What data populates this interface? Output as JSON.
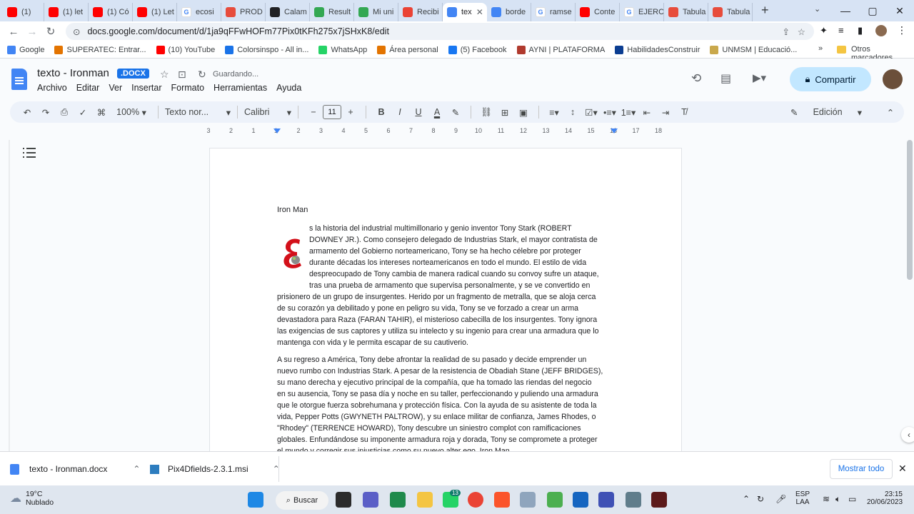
{
  "tabs": [
    {
      "label": "(1)",
      "icon": "youtube-icon"
    },
    {
      "label": "(1) let",
      "icon": "youtube-icon"
    },
    {
      "label": "(1) Có",
      "icon": "youtube-icon"
    },
    {
      "label": "(1) Let",
      "icon": "youtube-icon"
    },
    {
      "label": "ecosi",
      "icon": "google-icon"
    },
    {
      "label": "PROD",
      "icon": "tabulator-icon"
    },
    {
      "label": "Calam",
      "icon": "calameo-icon"
    },
    {
      "label": "Result",
      "icon": "drive-icon"
    },
    {
      "label": "Mi uni",
      "icon": "drive-icon"
    },
    {
      "label": "Recibi",
      "icon": "gmail-icon"
    },
    {
      "label": "tex",
      "icon": "docs-icon",
      "active": true
    },
    {
      "label": "borde",
      "icon": "docs-icon"
    },
    {
      "label": "ramse",
      "icon": "google-icon"
    },
    {
      "label": "Conte",
      "icon": "youtube-icon"
    },
    {
      "label": "EJERC",
      "icon": "google-icon"
    },
    {
      "label": "Tabula",
      "icon": "tabulator-icon"
    },
    {
      "label": "Tabula",
      "icon": "tabulator-icon"
    }
  ],
  "address": {
    "url": "docs.google.com/document/d/1ja9qFFwHOFm77Pix0tKFh275x7jSHxK8/edit"
  },
  "bookmarks": [
    {
      "label": "Google",
      "color": "#4285f4"
    },
    {
      "label": "SUPERATEC: Entrar...",
      "color": "#e37400"
    },
    {
      "label": "(10) YouTube",
      "color": "#ff0000"
    },
    {
      "label": "Colorsinspo - All in...",
      "color": "#1a73e8"
    },
    {
      "label": "WhatsApp",
      "color": "#25d366"
    },
    {
      "label": "Área personal",
      "color": "#e37400"
    },
    {
      "label": "(5) Facebook",
      "color": "#1877f2"
    },
    {
      "label": "AYNI | PLATAFORMA",
      "color": "#b03a2e"
    },
    {
      "label": "HabilidadesConstruir",
      "color": "#0b3d91"
    },
    {
      "label": "UNMSM | Educació...",
      "color": "#c9a84c"
    }
  ],
  "bookmarks_more": "Otros marcadores",
  "doc": {
    "title": "texto - Ironman",
    "badge": ".DOCX",
    "saving": "Guardando...",
    "menu": [
      "Archivo",
      "Editar",
      "Ver",
      "Insertar",
      "Formato",
      "Herramientas",
      "Ayuda"
    ],
    "share": "Compartir"
  },
  "toolbar": {
    "zoom": "100%",
    "style": "Texto nor...",
    "font": "Calibri",
    "size": "11",
    "mode": "Edición"
  },
  "ruler_labels": [
    "3",
    "2",
    "1",
    "1",
    "2",
    "3",
    "4",
    "5",
    "6",
    "7",
    "8",
    "9",
    "10",
    "11",
    "12",
    "13",
    "14",
    "15",
    "16",
    "17",
    "18"
  ],
  "page": {
    "heading": "Iron Man",
    "para1_lines": [
      "s la historia del industrial multimillonario y genio inventor Tony Stark (ROBERT",
      "DOWNEY JR.). Como consejero delegado de Industrias Stark, el mayor contratista de",
      "armamento del Gobierno norteamericano, Tony se ha hecho célebre por proteger",
      "durante décadas los intereses norteamericanos en todo el mundo. El estilo de vida",
      "despreocupado de Tony cambia de manera radical cuando su convoy sufre un ataque,",
      "tras una prueba de armamento que supervisa personalmente, y se ve convertido en"
    ],
    "para1_full_lines": [
      "prisionero de un grupo de insurgentes. Herido por un fragmento de metralla, que se aloja cerca",
      "de su corazón ya debilitado y pone en peligro su vida, Tony se ve forzado a crear un arma",
      "devastadora para Raza (FARAN TAHIR), el misterioso cabecilla de los insurgentes. Tony ignora",
      "las exigencias de sus captores y utiliza su intelecto y su ingenio para crear una armadura que lo",
      "mantenga con vida y le permita escapar de su cautiverio."
    ],
    "para2_lines": [
      "A su regreso a América, Tony debe afrontar la realidad de su pasado y decide emprender un",
      "nuevo rumbo con Industrias Stark. A pesar de la resistencia de Obadiah Stane (JEFF BRIDGES),",
      "su mano derecha y ejecutivo principal de la compañía, que ha tomado las riendas del negocio",
      "en su ausencia, Tony se pasa día y noche en su taller, perfeccionando y puliendo una armadura",
      "que le otorgue fuerza sobrehumana y protección física. Con la ayuda de su asistente de toda la",
      "vida, Pepper Potts (GWYNETH PALTROW), y su enlace militar de confianza, James Rhodes, o",
      "\"Rhodey\" (TERRENCE HOWARD), Tony descubre un siniestro complot con ramificaciones",
      "globales. Enfundándose su imponente armadura roja y dorada, Tony se compromete a proteger",
      "el mundo y corregir sus injusticias como su nuevo alter ego, Iron Man."
    ]
  },
  "downloads": {
    "items": [
      {
        "label": "texto - Ironman.docx"
      },
      {
        "label": "Pix4Dfields-2.3.1.msi"
      }
    ],
    "show_all": "Mostrar todo"
  },
  "taskbar": {
    "temp": "19°C",
    "weather": "Nublado",
    "search": "Buscar",
    "badge": "13",
    "lang1": "ESP",
    "lang2": "LAA",
    "time": "23:15",
    "date": "20/06/2023"
  }
}
